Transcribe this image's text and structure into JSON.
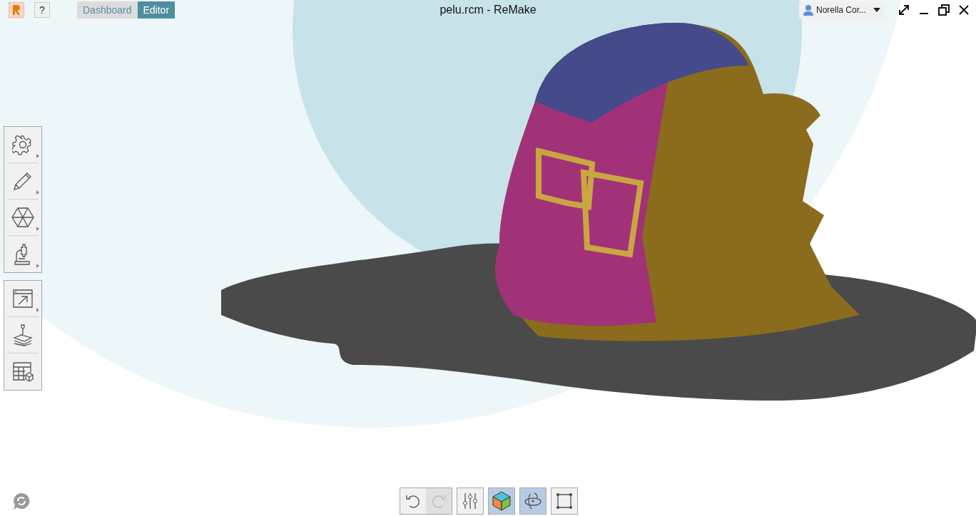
{
  "window": {
    "title": "pelu.rcm - ReMake",
    "help": "?"
  },
  "tabs": [
    {
      "label": "Dashboard",
      "selected": false
    },
    {
      "label": "Editor",
      "selected": true
    }
  ],
  "user": {
    "name": "Norella Cor..."
  },
  "left_toolbars": [
    [
      {
        "kind": "settings",
        "submenu": true
      },
      {
        "kind": "edit",
        "submenu": true
      },
      {
        "kind": "mesh",
        "submenu": true
      },
      {
        "kind": "analyze",
        "submenu": true
      }
    ],
    [
      {
        "kind": "export",
        "submenu": true
      },
      {
        "kind": "print",
        "submenu": false
      },
      {
        "kind": "grid",
        "submenu": false
      }
    ]
  ],
  "bottom_toolbar": [
    [
      {
        "kind": "undo",
        "active": false,
        "disabled": false
      },
      {
        "kind": "redo",
        "active": false,
        "disabled": true
      }
    ],
    [
      {
        "kind": "sliders",
        "active": false,
        "disabled": false
      }
    ],
    [
      {
        "kind": "cube",
        "active": true,
        "disabled": false
      }
    ],
    [
      {
        "kind": "orbit",
        "active": true,
        "disabled": false
      }
    ],
    [
      {
        "kind": "frame",
        "active": false,
        "disabled": false
      }
    ]
  ]
}
